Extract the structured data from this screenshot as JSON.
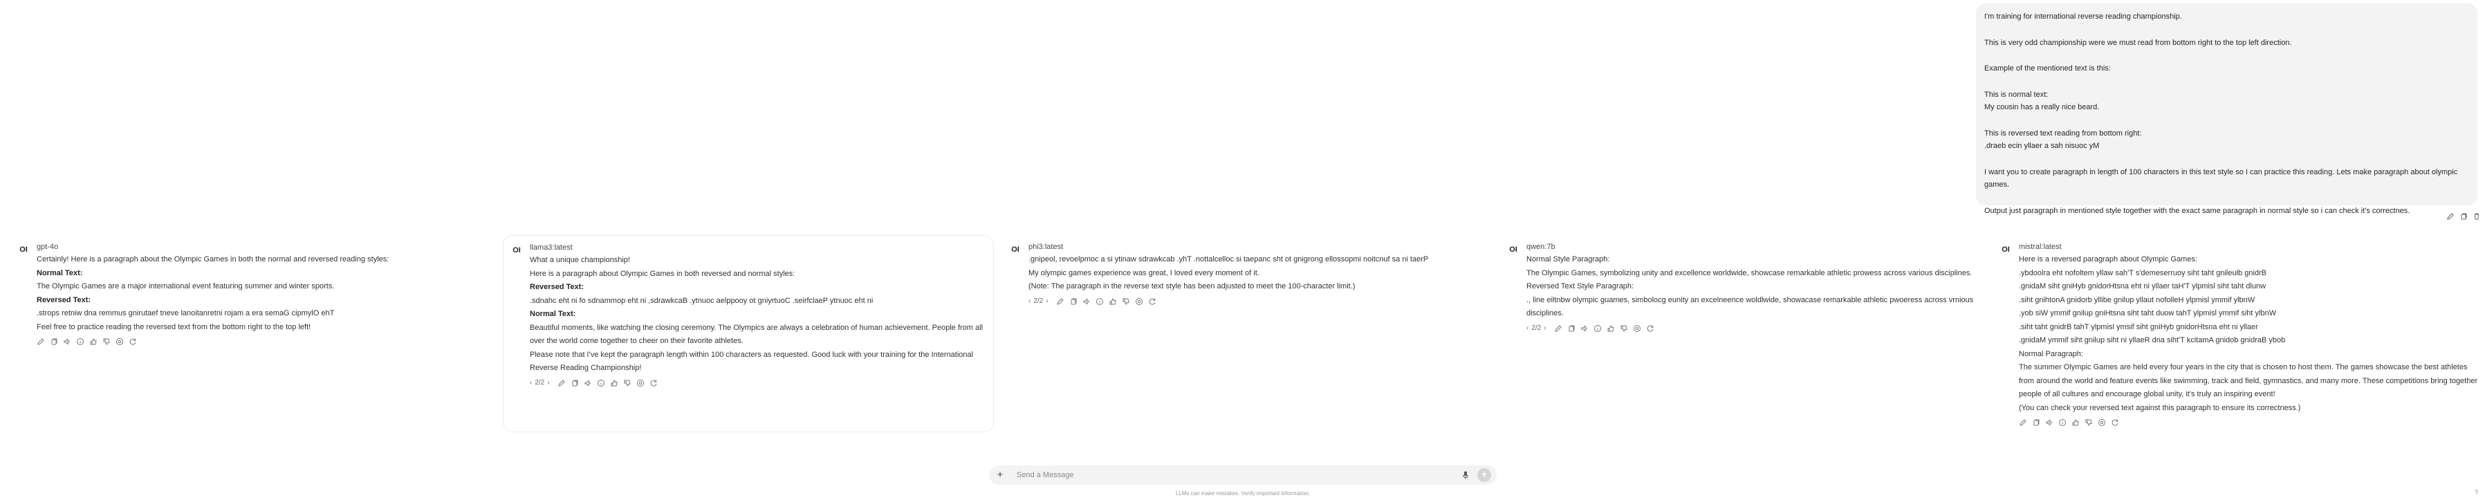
{
  "user_message": {
    "lines": [
      "I'm training for international reverse reading championship.",
      "",
      "This is very odd championship were we must read from bottom right to the top left direction.",
      "",
      "Example of the mentioned text is this:",
      "",
      "This is normal text:",
      "My cousin has a really nice beard.",
      "",
      "This is reversed text reading from bottom right:",
      ".draeb ecin yllaer a sah nisuoc yM",
      "",
      "I want you to create paragraph in length of 100 characters in this text style so I can practice this reading. Lets make paragraph about olympic games.",
      "",
      "Output just paragraph in mentioned style together with the exact same paragraph in normal style so i can check it's correctnes."
    ]
  },
  "responses": [
    {
      "model": "gpt-4o",
      "lines": [
        {
          "t": "Certainly! Here is a paragraph about the Olympic Games in both the normal and reversed reading styles:",
          "b": false
        },
        {
          "t": "Normal Text:",
          "b": true
        },
        {
          "t": "The Olympic Games are a major international event featuring summer and winter sports.",
          "b": false
        },
        {
          "t": "Reversed Text:",
          "b": true
        },
        {
          "t": ".strops retniw dna remmus gnirutaef tneve lanoitanretni rojam a era semaG cipmylO ehT",
          "b": false
        },
        {
          "t": "Feel free to practice reading the reversed text from the bottom right to the top left!",
          "b": false
        }
      ],
      "pager": ""
    },
    {
      "model": "llama3:latest",
      "lines": [
        {
          "t": "What a unique championship!",
          "b": false
        },
        {
          "t": "Here is a paragraph about Olympic Games in both reversed and normal styles:",
          "b": false
        },
        {
          "t": "Reversed Text:",
          "b": true
        },
        {
          "t": ".sdnahc eht ni fo sdnammop eht ni ,sdrawkcaB .ytnuoc aelppooy ot gniyrtuoC .seirfclaeP ytnuoc eht ni",
          "b": false
        },
        {
          "t": "Normal Text:",
          "b": true
        },
        {
          "t": "Beautiful moments, like watching the closing ceremony. The Olympics are always a celebration of human achievement. People from all",
          "b": false
        },
        {
          "t": "over the world come together to cheer on their favorite athletes.",
          "b": false
        },
        {
          "t": "Please note that I've kept the paragraph length within 100 characters as requested. Good luck with your training for the International",
          "b": false
        },
        {
          "t": "Reverse Reading Championship!",
          "b": false
        }
      ],
      "pager": "2/2"
    },
    {
      "model": "phi3:latest",
      "lines": [
        {
          "t": ".gnipeol, revoelpmoc a si ytinaw sdrawkcab .yhT .nottalcelloc si taepanc sht ot gnigrong ellossopmi noitcnuf sa ni taerP",
          "b": false
        },
        {
          "t": "My olympic games experience was great, I loved every moment of it.",
          "b": false
        },
        {
          "t": "(Note: The paragraph in the reverse text style has been adjusted to meet the 100-character limit.)",
          "b": false
        }
      ],
      "pager": "2/2"
    },
    {
      "model": "qwen:7b",
      "lines": [
        {
          "t": "Normal Style Paragraph:",
          "b": false
        },
        {
          "t": "The Olympic Games, symbolizing unity and excellence worldwide, showcase remarkable athletic prowess across various disciplines.",
          "b": false
        },
        {
          "t": "Reversed Text Style Paragraph:",
          "b": false
        },
        {
          "t": "., line eiltnbw olympic guames, simbolocg eunity an excelneence woldlwide, showacase remarkable athletic pwoeress across vrnious",
          "b": false
        },
        {
          "t": "disciplines.",
          "b": false
        }
      ],
      "pager": "2/2"
    },
    {
      "model": "mistral:latest",
      "lines": [
        {
          "t": "Here is a reversed paragraph about Olympic Games:",
          "b": false
        },
        {
          "t": ".ybdoolra eht nofoltem yllaw sah'T s'demeserruoy siht taht gnileulb gnidrB",
          "b": false
        },
        {
          "t": ".gnidaM siht gniHyb gnidorHtsna eht ni yllaer taH'T ylpmisl siht taht dlunw",
          "b": false
        },
        {
          "t": ".siht gnihtonA gnidorb yllibe gnilup yllaut nofolleH ylpmisl ymmif ylbnW",
          "b": false
        },
        {
          "t": ".yob siW ymmif gnilup gniHtsna siht taht duow tahT ylpmisl ymmif siht ylbnW",
          "b": false
        },
        {
          "t": ".siht taht gnidrB tahT ylpmisl ymsif siht gniHyb gnidorHtsna eht ni yllaer",
          "b": false
        },
        {
          "t": ".gnidaM ymmif siht gnilup siht ni yllaeR dna siht'T kcitamA gnidob gnidraB ybob",
          "b": false
        },
        {
          "t": "Normal Paragraph:",
          "b": false
        },
        {
          "t": "The summer Olympic Games are held every four years in the city that is chosen to host them. The games showcase the best athletes",
          "b": false
        },
        {
          "t": "from around the world and feature events like swimming, track and field, gymnastics, and many more. These competitions bring together",
          "b": false
        },
        {
          "t": "people of all cultures and encourage global unity, it's truly an inspiring event!",
          "b": false
        },
        {
          "t": "(You can check your reversed text against this paragraph to ensure its correctness.)",
          "b": false
        }
      ],
      "pager": ""
    }
  ],
  "input": {
    "placeholder": "Send a Message",
    "disclaimer": "LLMs can make mistakes. Verify important information.",
    "help": "?"
  },
  "avatar_text": "OI"
}
